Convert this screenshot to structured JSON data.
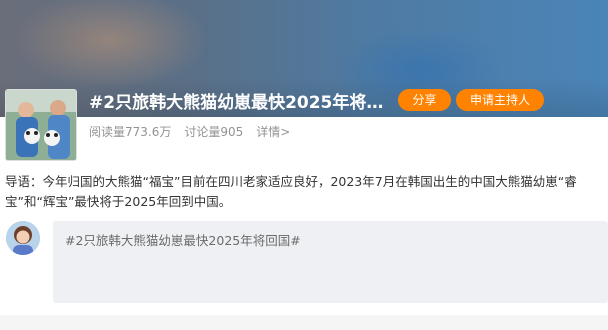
{
  "topic": {
    "title": "#2只旅韩大熊猫幼崽最快2025年将…",
    "share_label": "分享",
    "host_label": "申请主持人",
    "reads": "阅读量773.6万",
    "discussions": "讨论量905",
    "details": "详情>"
  },
  "lead": {
    "text": "导语：今年归国的大熊猫“福宝”目前在四川老家适应良好，2023年7月在韩国出生的中国大熊猫幼崽“睿宝”和“辉宝”最快将于2025年回到中国。"
  },
  "composer": {
    "prefill": "#2只旅韩大熊猫幼崽最快2025年将回国#"
  },
  "colors": {
    "accent": "#ff8200",
    "hero_blue": "#4a85b8",
    "composer_bg": "#eff0f4"
  }
}
